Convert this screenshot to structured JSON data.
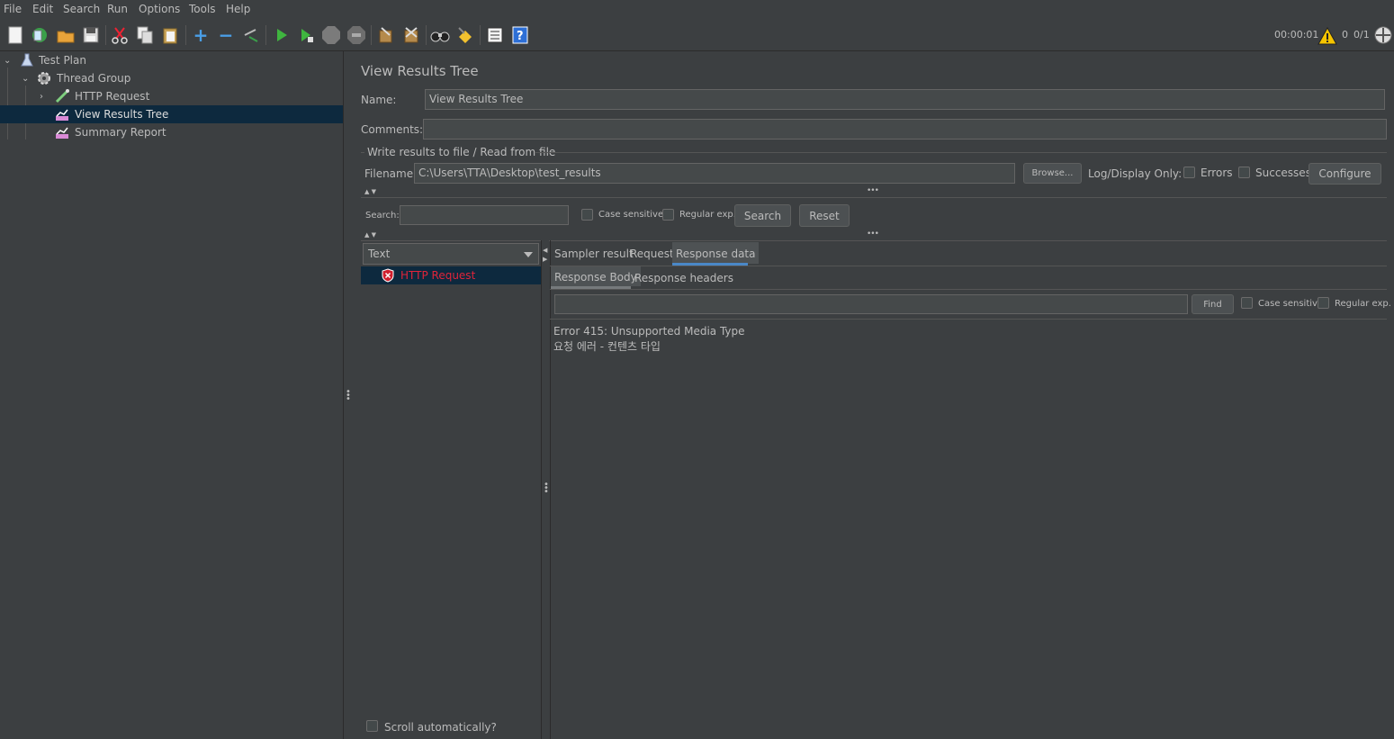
{
  "menu": [
    "File",
    "Edit",
    "Search",
    "Run",
    "Options",
    "Tools",
    "Help"
  ],
  "toolbar": {
    "icons": [
      "new-icon",
      "templates-icon",
      "open-icon",
      "save-icon",
      "cut-icon",
      "copy-icon",
      "paste-icon",
      "expand-icon",
      "collapse-icon",
      "toggle-icon",
      "start-icon",
      "start-no-pause-icon",
      "stop-icon",
      "shutdown-icon",
      "clear-icon",
      "clear-all-icon",
      "search-icon",
      "reset-search-icon",
      "function-helper-icon",
      "help-icon"
    ],
    "timer": "00:00:01",
    "warning_count": "0",
    "threads": "0/1"
  },
  "tree": {
    "items": [
      {
        "label": "Test Plan",
        "icon": "flask-icon"
      },
      {
        "label": "Thread Group",
        "icon": "gear-icon"
      },
      {
        "label": "HTTP Request",
        "icon": "pipette-icon"
      },
      {
        "label": "View Results Tree",
        "icon": "chart-icon"
      },
      {
        "label": "Summary Report",
        "icon": "chart-icon"
      }
    ]
  },
  "panel": {
    "title": "View Results Tree",
    "name_label": "Name:",
    "name_value": "View Results Tree",
    "comments_label": "Comments:",
    "comments_value": "",
    "file_section": "Write results to file / Read from file",
    "filename_label": "Filename",
    "filename_value": "C:\\Users\\TTA\\Desktop\\test_results",
    "browse": "Browse...",
    "log_display": "Log/Display Only:",
    "errors": "Errors",
    "successes": "Successes",
    "configure": "Configure"
  },
  "search": {
    "label": "Search:",
    "value": "",
    "case_sensitive": "Case sensitive",
    "regex": "Regular exp.",
    "search_btn": "Search",
    "reset_btn": "Reset"
  },
  "results": {
    "renderer": "Text",
    "items": [
      {
        "label": "HTTP Request",
        "status": "error"
      }
    ],
    "scroll_auto": "Scroll automatically?"
  },
  "tabs": {
    "main": [
      "Sampler result",
      "Request",
      "Response data"
    ],
    "sub": [
      "Response Body",
      "Response headers"
    ]
  },
  "find": {
    "value": "",
    "find_btn": "Find",
    "case_sensitive": "Case sensitive",
    "regex": "Regular exp."
  },
  "response": {
    "line1": "Error 415: Unsupported Media Type",
    "line2": "요청 에러 - 컨텐츠 타입"
  },
  "colors": {
    "background": "#3c3f41",
    "selection": "#0d293e",
    "error_text": "#e0243a",
    "accent": "#4a88c7"
  }
}
